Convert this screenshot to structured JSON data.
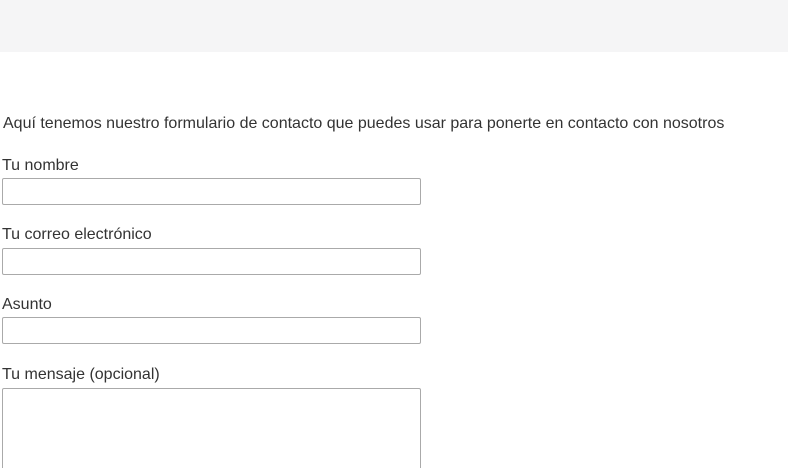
{
  "intro_text": "Aquí tenemos nuestro formulario de contacto que puedes usar para ponerte en contacto con nosotros",
  "form": {
    "name_label": "Tu nombre",
    "name_value": "",
    "email_label": "Tu correo electrónico",
    "email_value": "",
    "subject_label": "Asunto",
    "subject_value": "",
    "message_label": "Tu mensaje (opcional)",
    "message_value": ""
  },
  "colors": {
    "banner": "#f5f5f6",
    "text": "#333333",
    "input_border": "#aaaaaa"
  }
}
